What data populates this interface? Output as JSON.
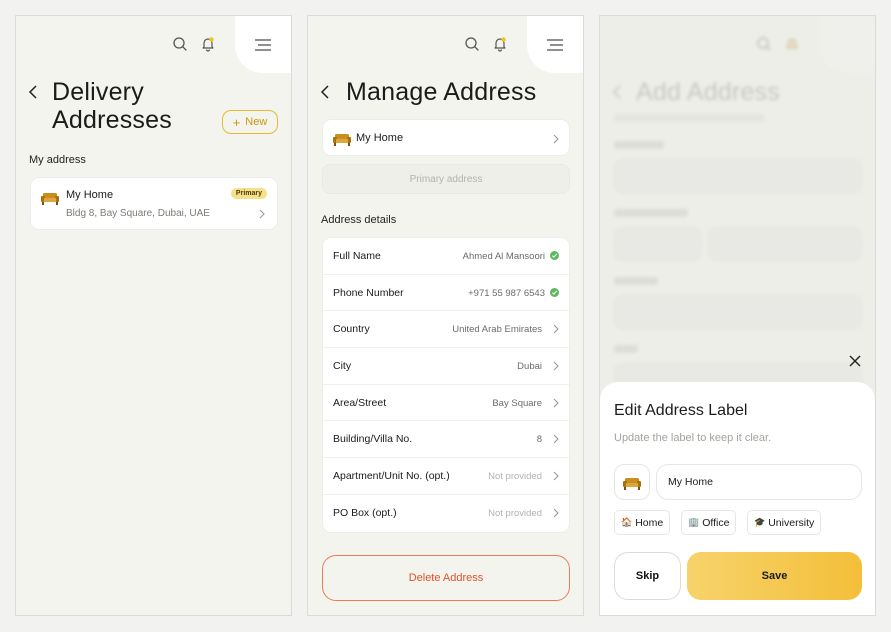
{
  "colors": {
    "accent": "#e8b92f",
    "danger": "#e0522a",
    "success": "#5cb85c",
    "badge": "#f6e18a"
  },
  "icons": {
    "search": "search-icon",
    "bell": "bell-icon",
    "menu": "menu-icon",
    "back": "back-arrow-icon",
    "chevron": "chevron-right-icon",
    "check": "check-circle-icon",
    "close": "close-icon",
    "label": "sofa-icon"
  },
  "screen1": {
    "title_line1": "Delivery",
    "title_line2": "Addresses",
    "new_button": "New",
    "section_label": "My address",
    "address": {
      "label": "My Home",
      "badge": "Primary",
      "detail": "Bldg 8, Bay Square, Dubai, UAE"
    }
  },
  "screen2": {
    "title": "Manage Address",
    "address_label": "My Home",
    "primary_button": "Primary address",
    "section_label": "Address details",
    "rows": [
      {
        "label": "Full Name",
        "value": "Ahmed Al Mansoori"
      },
      {
        "label": "Phone Number",
        "value": "+971 55 987 6543"
      },
      {
        "label": "Country",
        "value": "United Arab Emirates"
      },
      {
        "label": "City",
        "value": "Dubai"
      },
      {
        "label": "Area/Street",
        "value": "Bay Square"
      },
      {
        "label": "Building/Villa No.",
        "value": "8"
      },
      {
        "label": "Apartment/Unit No. (opt.)",
        "value": "Not provided"
      },
      {
        "label": "PO Box (opt.)",
        "value": "Not provided"
      }
    ],
    "delete_button": "Delete Address"
  },
  "screen3": {
    "bg_title": "Add Address",
    "sheet_title": "Edit Address Label",
    "sheet_subtitle": "Update the label to keep it clear.",
    "label_value": "My Home",
    "chips": [
      {
        "emoji": "🏠",
        "label": "Home"
      },
      {
        "emoji": "🏢",
        "label": "Office"
      },
      {
        "emoji": "🎓",
        "label": "University"
      }
    ],
    "skip_button": "Skip",
    "save_button": "Save"
  }
}
